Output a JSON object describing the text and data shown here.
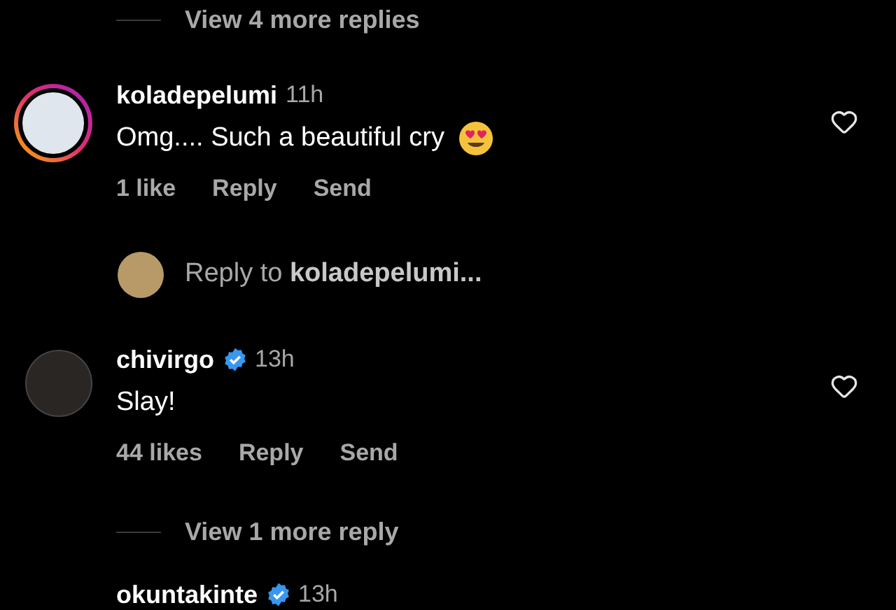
{
  "items": [
    {
      "kind": "toggle",
      "label": "View 4 more replies"
    },
    {
      "kind": "comment",
      "username": "koladepelumi",
      "verified": false,
      "story_ring": true,
      "time": "11h",
      "text": "Omg.... Such a beautiful cry",
      "emoji": true,
      "likes": "1 like",
      "actions": [
        "Reply",
        "Send"
      ]
    },
    {
      "kind": "reply_prompt",
      "prefix": "Reply to",
      "username": "koladepelumi..."
    },
    {
      "kind": "comment",
      "username": "chivirgo",
      "verified": true,
      "story_ring": false,
      "time": "13h",
      "text": "Slay!",
      "emoji": false,
      "likes": "44 likes",
      "actions": [
        "Reply",
        "Send"
      ]
    },
    {
      "kind": "toggle",
      "label": "View 1 more reply"
    },
    {
      "kind": "partial",
      "username": "okuntakinte",
      "verified": true,
      "time": "13h"
    }
  ]
}
